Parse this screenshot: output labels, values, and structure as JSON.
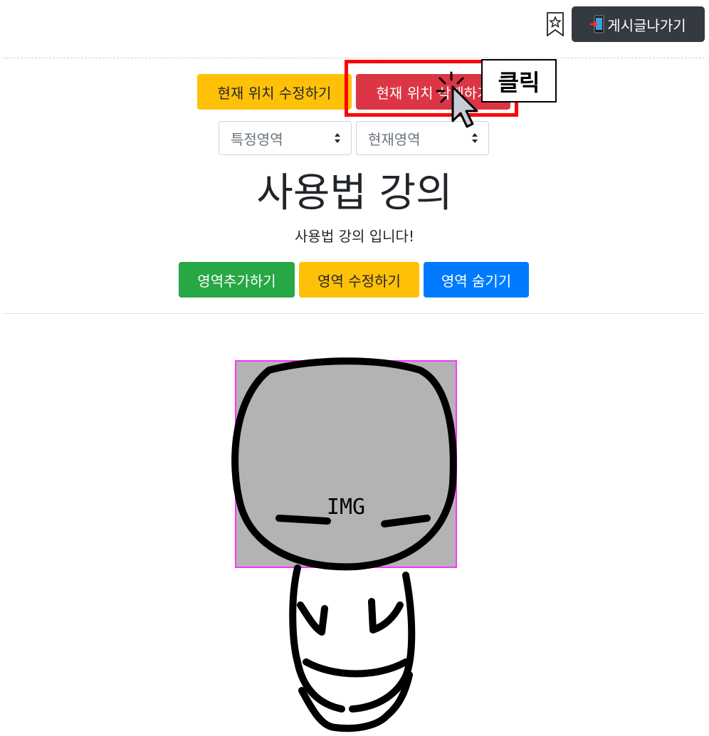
{
  "topbar": {
    "bookmark_icon": "bookmark-star-icon",
    "exit_icon": "mobile-exit-icon",
    "exit_label": "게시글나가기"
  },
  "actions": {
    "edit_location_label": "현재 위치 수정하기",
    "delete_location_label": "현재 위치 삭제하기"
  },
  "selects": {
    "area_select": {
      "selected": "특정영역"
    },
    "current_select": {
      "selected": "현재영역"
    }
  },
  "content": {
    "title": "사용법 강의",
    "subtitle": "사용법 강의 입니다!"
  },
  "area_buttons": {
    "add_label": "영역추가하기",
    "edit_label": "영역 수정하기",
    "hide_label": "영역 숨기기"
  },
  "annotation": {
    "click_label": "클릭"
  },
  "image": {
    "label": "IMG",
    "box_color": "#ff33ff",
    "fill_color": "#b3b3b3"
  },
  "colors": {
    "warning": "#ffc107",
    "danger": "#dc3545",
    "success": "#28a745",
    "primary": "#007bff",
    "dark": "#343a40",
    "highlight": "#ff0000"
  }
}
